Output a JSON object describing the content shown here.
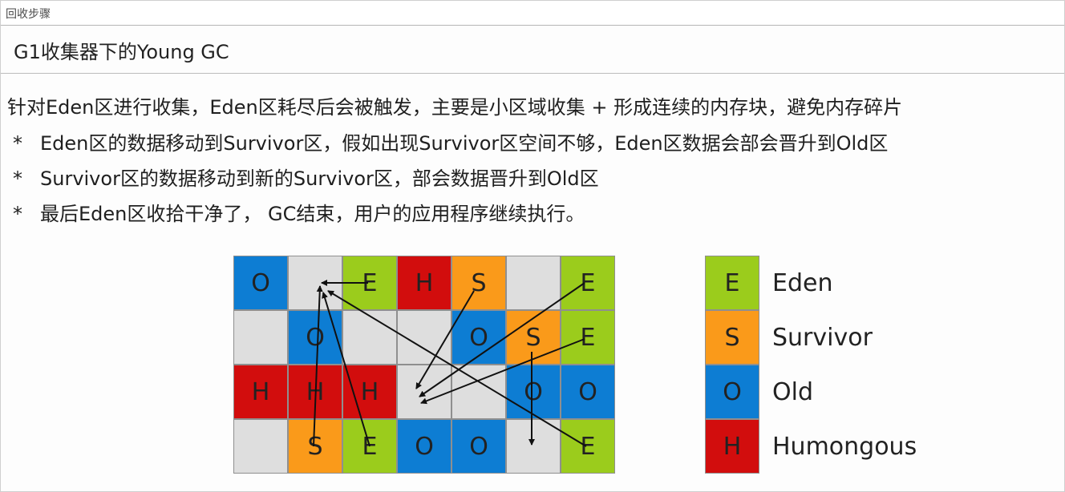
{
  "window": {
    "title": "回收步骤"
  },
  "slide": {
    "heading": "G1收集器下的Young GC",
    "intro": "针对Eden区进行收集，Eden区耗尽后会被触发，主要是小区域收集 + 形成连续的内存块，避免内存碎片",
    "bullets": [
      {
        "mark": "*",
        "text": "Eden区的数据移动到Survivor区，假如出现Survivor区空间不够，Eden区数据会部会晋升到Old区"
      },
      {
        "mark": "*",
        "text": "Survivor区的数据移动到新的Survivor区，部会数据晋升到Old区"
      },
      {
        "mark": "*",
        "text": "最后Eden区收拾干净了， GC结束，用户的应用程序继续执行。"
      }
    ]
  },
  "region_grid": {
    "rows": [
      [
        {
          "type": "O",
          "label": "O"
        },
        {
          "type": "blank",
          "label": ""
        },
        {
          "type": "E",
          "label": "E"
        },
        {
          "type": "H",
          "label": "H"
        },
        {
          "type": "S",
          "label": "S"
        },
        {
          "type": "blank",
          "label": ""
        },
        {
          "type": "E",
          "label": "E"
        }
      ],
      [
        {
          "type": "blank",
          "label": ""
        },
        {
          "type": "O",
          "label": "O"
        },
        {
          "type": "blank",
          "label": ""
        },
        {
          "type": "blank",
          "label": ""
        },
        {
          "type": "O",
          "label": "O"
        },
        {
          "type": "S",
          "label": "S"
        },
        {
          "type": "E",
          "label": "E"
        }
      ],
      [
        {
          "type": "H",
          "label": "H"
        },
        {
          "type": "H",
          "label": "H"
        },
        {
          "type": "H",
          "label": "H"
        },
        {
          "type": "blank",
          "label": ""
        },
        {
          "type": "blank",
          "label": ""
        },
        {
          "type": "O",
          "label": "O"
        },
        {
          "type": "O",
          "label": "O"
        }
      ],
      [
        {
          "type": "blank",
          "label": ""
        },
        {
          "type": "S",
          "label": "S"
        },
        {
          "type": "E",
          "label": "E"
        },
        {
          "type": "O",
          "label": "O"
        },
        {
          "type": "O",
          "label": "O"
        },
        {
          "type": "blank",
          "label": ""
        },
        {
          "type": "E",
          "label": "E"
        }
      ]
    ]
  },
  "legend": {
    "items": [
      {
        "key": "E",
        "type": "E",
        "label": "Eden"
      },
      {
        "key": "S",
        "type": "S",
        "label": "Survivor"
      },
      {
        "key": "O",
        "type": "O",
        "label": "Old"
      },
      {
        "key": "H",
        "type": "H",
        "label": "Humongous"
      }
    ]
  },
  "colors": {
    "eden": "#9bcc1c",
    "survivor": "#fa9a1a",
    "old": "#0d7dd3",
    "humongous": "#d20d0d",
    "free": "#dedede",
    "arrow": "#111111"
  }
}
